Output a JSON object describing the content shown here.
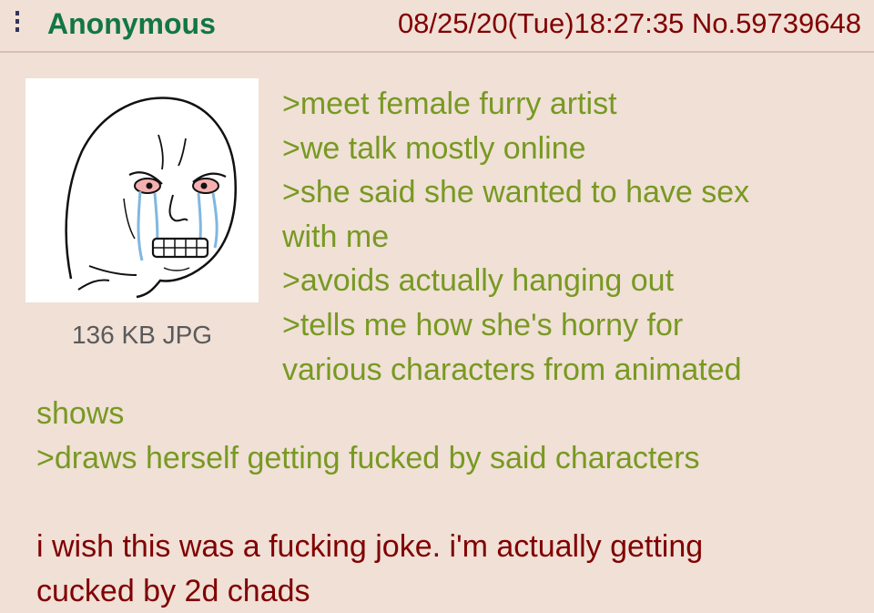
{
  "post": {
    "name": "Anonymous",
    "datetime": "08/25/20(Tue)18:27:35",
    "number": "No.59739648",
    "file_info": "136 KB JPG",
    "thumbnail_icon": "crying-wojak-icon",
    "quote_lines": [
      ">meet female furry artist",
      ">we talk mostly online",
      ">she said she wanted to have sex",
      "with me",
      ">avoids actually hanging out",
      ">tells me how she's horny for",
      "various characters from animated",
      "shows",
      ">draws herself getting fucked by said characters"
    ],
    "message_lines": [
      "i wish this was a fucking joke. i'm actually getting",
      "cucked by 2d chads"
    ]
  },
  "colors": {
    "background": "#f0e0d6",
    "name": "#117743",
    "quote": "#789922",
    "text": "#800000",
    "file_info": "#5a5a5a"
  }
}
